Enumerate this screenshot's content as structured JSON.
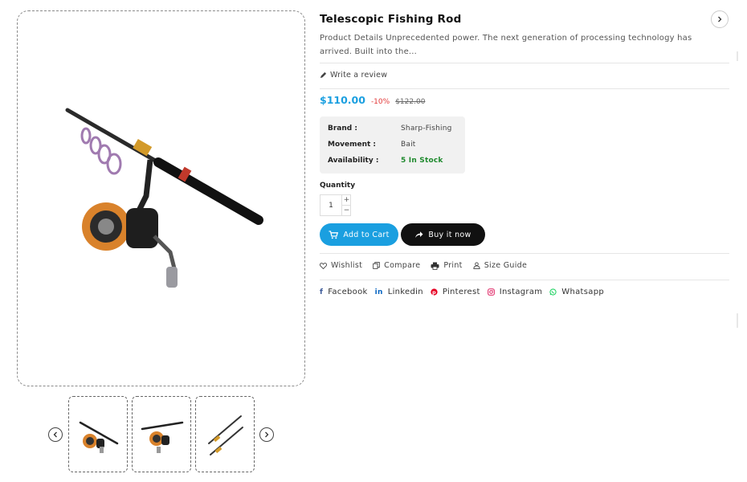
{
  "product": {
    "title": "Telescopic Fishing Rod",
    "description": "Product Details Unprecedented power. The next generation of processing technology has arrived. Built into the...",
    "review_label": "Write a review",
    "price": "$110.00",
    "discount": "-10%",
    "old_price": "$122.00"
  },
  "specs": [
    {
      "label": "Brand :",
      "value": "Sharp-Fishing"
    },
    {
      "label": "Movement :",
      "value": "Bait"
    },
    {
      "label": "Availability :",
      "value": "5 In Stock"
    }
  ],
  "quantity": {
    "label": "Quantity",
    "value": "1",
    "plus": "+",
    "minus": "−"
  },
  "buttons": {
    "add_to_cart": "Add to Cart",
    "buy_now": "Buy it now"
  },
  "actions": [
    {
      "label": "Wishlist",
      "icon": "heart-icon"
    },
    {
      "label": "Compare",
      "icon": "compare-icon"
    },
    {
      "label": "Print",
      "icon": "print-icon"
    },
    {
      "label": "Size Guide",
      "icon": "size-guide-icon"
    }
  ],
  "social": [
    {
      "label": "Facebook",
      "icon": "facebook-icon",
      "color": "#3b5998"
    },
    {
      "label": "Linkedin",
      "icon": "linkedin-icon",
      "color": "#0a66c2"
    },
    {
      "label": "Pinterest",
      "icon": "pinterest-icon",
      "color": "#e60023"
    },
    {
      "label": "Instagram",
      "icon": "instagram-icon",
      "color": "#e1306c"
    },
    {
      "label": "Whatsapp",
      "icon": "whatsapp-icon",
      "color": "#25d366"
    }
  ],
  "colors": {
    "accent": "#1a9fe0",
    "discount": "#e23838",
    "in_stock": "#1f8a2e",
    "buy_button": "#111111"
  }
}
